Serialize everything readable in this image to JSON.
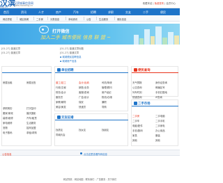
{
  "header": {
    "logo": "汉滨",
    "logo_sub": "ing.cn",
    "slogan": "汉滨城事信息网",
    "site_url": "www.hanbing.cn",
    "top_right_prefix": "收藏本站",
    "top_right_highlight": "免费发布",
    "top_right_suffix": "会员中心"
  },
  "nav": {
    "items": [
      "首页",
      "资讯",
      "人才",
      "房产",
      "汽车",
      "招聘",
      "求职",
      "交友",
      "二手",
      "便民"
    ]
  },
  "subnav": {
    "items": [
      "网站导航",
      "城区新闻",
      "二手房",
      "分类信息",
      "本地资讯",
      "公告",
      "生活服务",
      "便民信息"
    ]
  },
  "banner": {
    "title": "打开微信",
    "subtitle": "加入二手 城市便民 信息 联 盟 ~"
  },
  "news": {
    "left_1": "[01-27] 普通文章",
    "left_2": "[01-27] 普通文章",
    "mid_1": "[01-27] 普通文章标题",
    "mid_2": "[01-27] 普通文章",
    "right_1": "▪ 城城便民招聘信息",
    "right_2": "▪ 城城房产信息"
  },
  "panels": {
    "left_title": "",
    "jobs_title": "单位招聘",
    "life_title": "便民查询",
    "second_title": "二手市场",
    "dating_title": "交友征婚"
  },
  "jobs": {
    "col1": [
      "普工/技工",
      "行政/文秘",
      "财务/会计",
      "服务员",
      "家教/辅导",
      "美容/美发"
    ],
    "col2": [
      "会计/出纳",
      "销售/业务",
      "客服/咨询",
      "广告/设计",
      "保安",
      "快递员"
    ],
    "col3": [
      "司机/驾驶",
      "管理/顾问",
      "房产经纪",
      "物流/仓储",
      "兼职",
      "导购"
    ]
  },
  "left_col": {
    "items": [
      "房屋出租",
      "房屋出售",
      "求职简历",
      "打字复印",
      "搬家/家政",
      "婚庆摄影",
      "装修/维修",
      "汽车/租赁",
      "家电维修",
      "生活服务",
      "宠物",
      "招商加盟",
      "电子数码",
      "求租/求购"
    ]
  },
  "life": {
    "col1": [
      "天气预报",
      "公交查询",
      "列车时刻",
      "快递查询"
    ],
    "col2": [
      "身份证查询",
      "邮编区号",
      "手机归属地",
      "IP查询"
    ]
  },
  "second": {
    "col1": [
      "二手房",
      "二手车",
      "电脑/配件",
      "手机/数码",
      "家具",
      "其他"
    ],
    "col2": [
      "二手电脑",
      "二手手机",
      "二手家电",
      "办公用品",
      "服装",
      "其他"
    ]
  },
  "dating": {
    "items": [
      "找男友",
      "找女友",
      "找朋友",
      "同城约会"
    ]
  },
  "notice": {
    "left": "公告信息",
    "mid": "点击这里查看所有信息"
  },
  "footer": {
    "line": "网站导航 - 网站地图 - 联系我们 - 广告服务 - 关于我们"
  },
  "colors": {
    "brand": "#1e74c9",
    "accent": "#e8341c"
  }
}
